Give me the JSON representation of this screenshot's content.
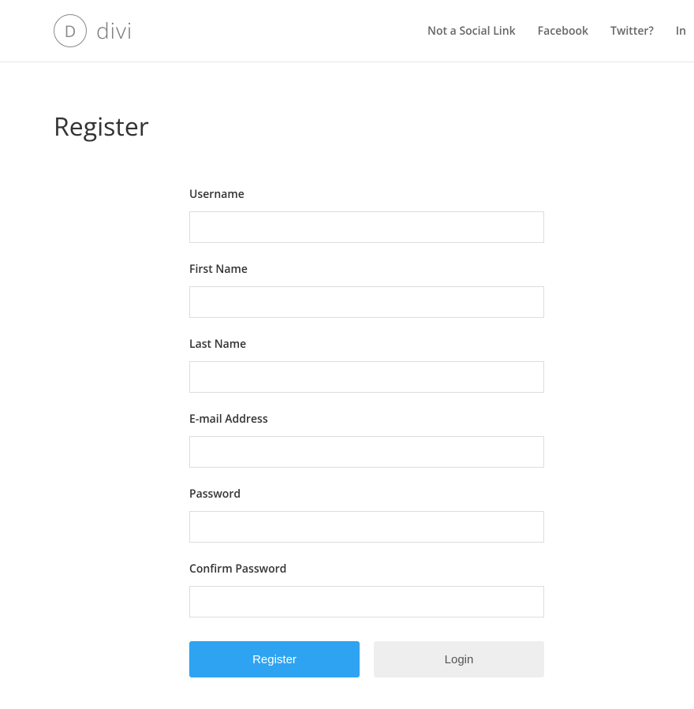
{
  "header": {
    "logo_letter": "D",
    "logo_text": "divi",
    "nav": [
      "Not a Social Link",
      "Facebook",
      "Twitter?",
      "In"
    ]
  },
  "page": {
    "title": "Register"
  },
  "form": {
    "fields": [
      {
        "label": "Username",
        "value": ""
      },
      {
        "label": "First Name",
        "value": ""
      },
      {
        "label": "Last Name",
        "value": ""
      },
      {
        "label": "E-mail Address",
        "value": ""
      },
      {
        "label": "Password",
        "value": ""
      },
      {
        "label": "Confirm Password",
        "value": ""
      }
    ],
    "buttons": {
      "register": "Register",
      "login": "Login"
    }
  }
}
